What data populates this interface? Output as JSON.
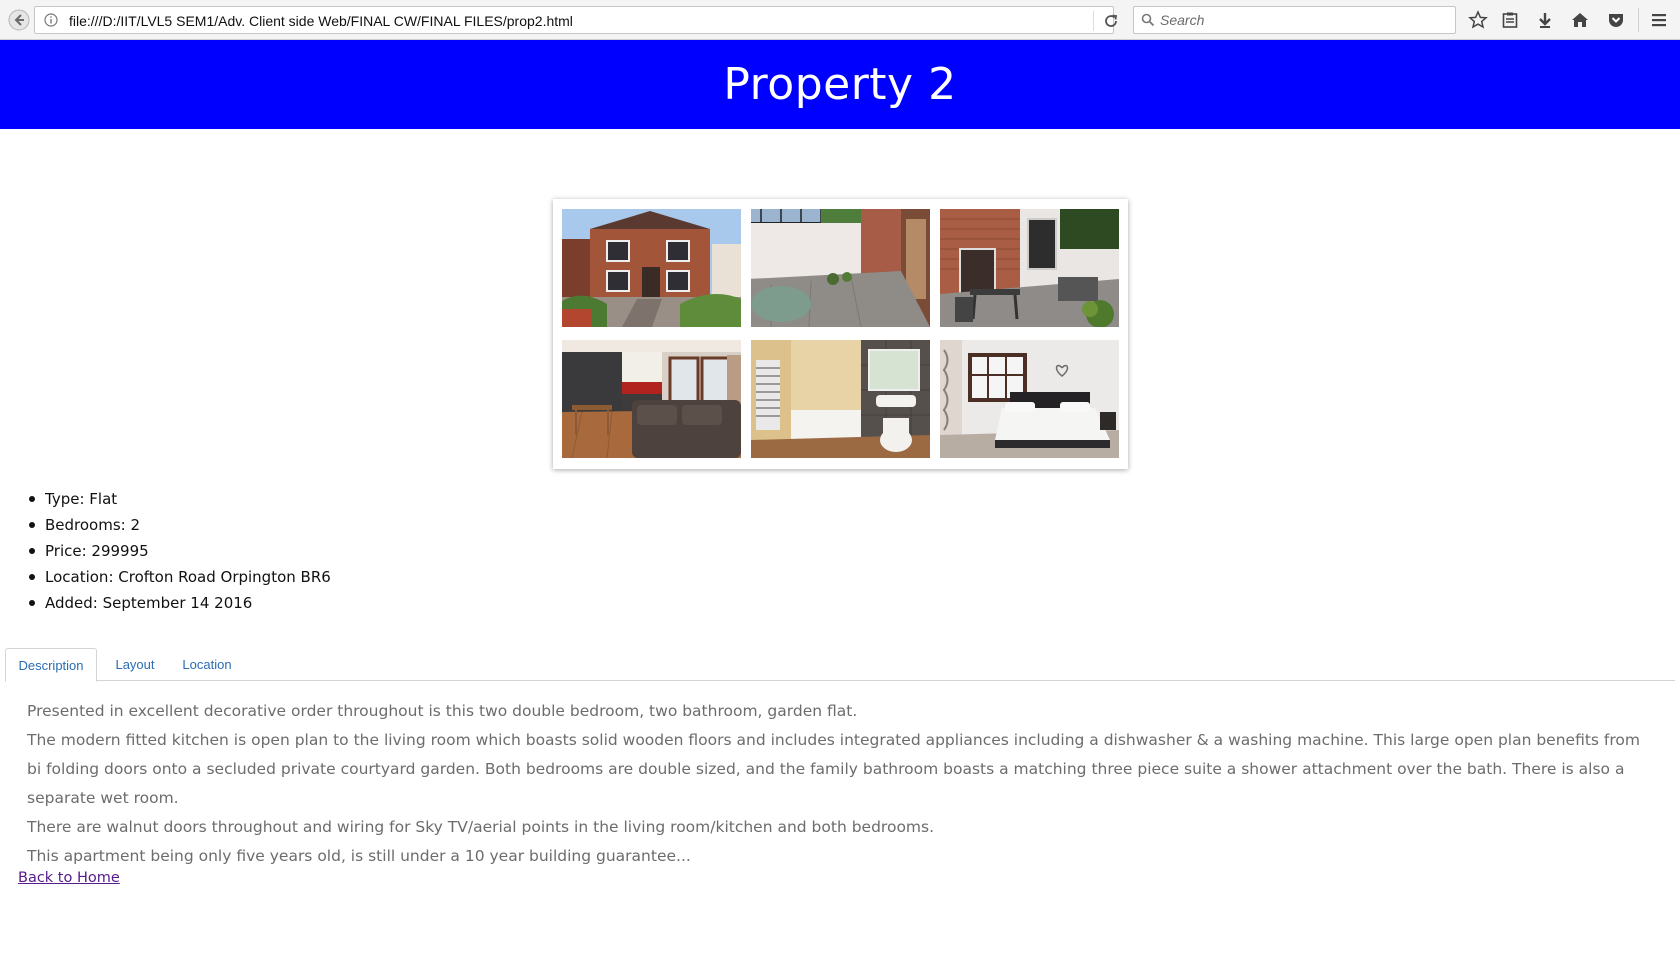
{
  "browser": {
    "url": "file:///D:/IIT/LVL5 SEM1/Adv. Client side Web/FINAL CW/FINAL FILES/prop2.html",
    "search_placeholder": "Search"
  },
  "header": {
    "title": "Property 2",
    "background_color": "#0000ff"
  },
  "gallery": {
    "images": [
      {
        "name": "exterior-house-photo"
      },
      {
        "name": "courtyard-patio-photo"
      },
      {
        "name": "garden-furniture-photo"
      },
      {
        "name": "kitchen-living-photo"
      },
      {
        "name": "bathroom-photo"
      },
      {
        "name": "bedroom-photo"
      }
    ]
  },
  "details": [
    "Type: Flat",
    "Bedrooms: 2",
    "Price: 299995",
    "Location: Crofton Road Orpington BR6",
    "Added: September 14 2016"
  ],
  "tabs": [
    {
      "label": "Description",
      "active": true
    },
    {
      "label": "Layout",
      "active": false
    },
    {
      "label": "Location",
      "active": false
    }
  ],
  "description": [
    "Presented in excellent decorative order throughout is this two double bedroom, two bathroom, garden flat.",
    "The modern fitted kitchen is open plan to the living room which boasts solid wooden floors and includes integrated appliances including a dishwasher & a washing machine. This large open plan benefits from bi folding doors onto a secluded private courtyard garden. Both bedrooms are double sized, and the family bathroom boasts a matching three piece suite a shower attachment over the bath. There is also a separate wet room.",
    "There are walnut doors throughout and wiring for Sky TV/aerial points in the living room/kitchen and both bedrooms.",
    "This apartment being only five years old, is still under a 10 year building guarantee..."
  ],
  "back_link": "Back to Home"
}
